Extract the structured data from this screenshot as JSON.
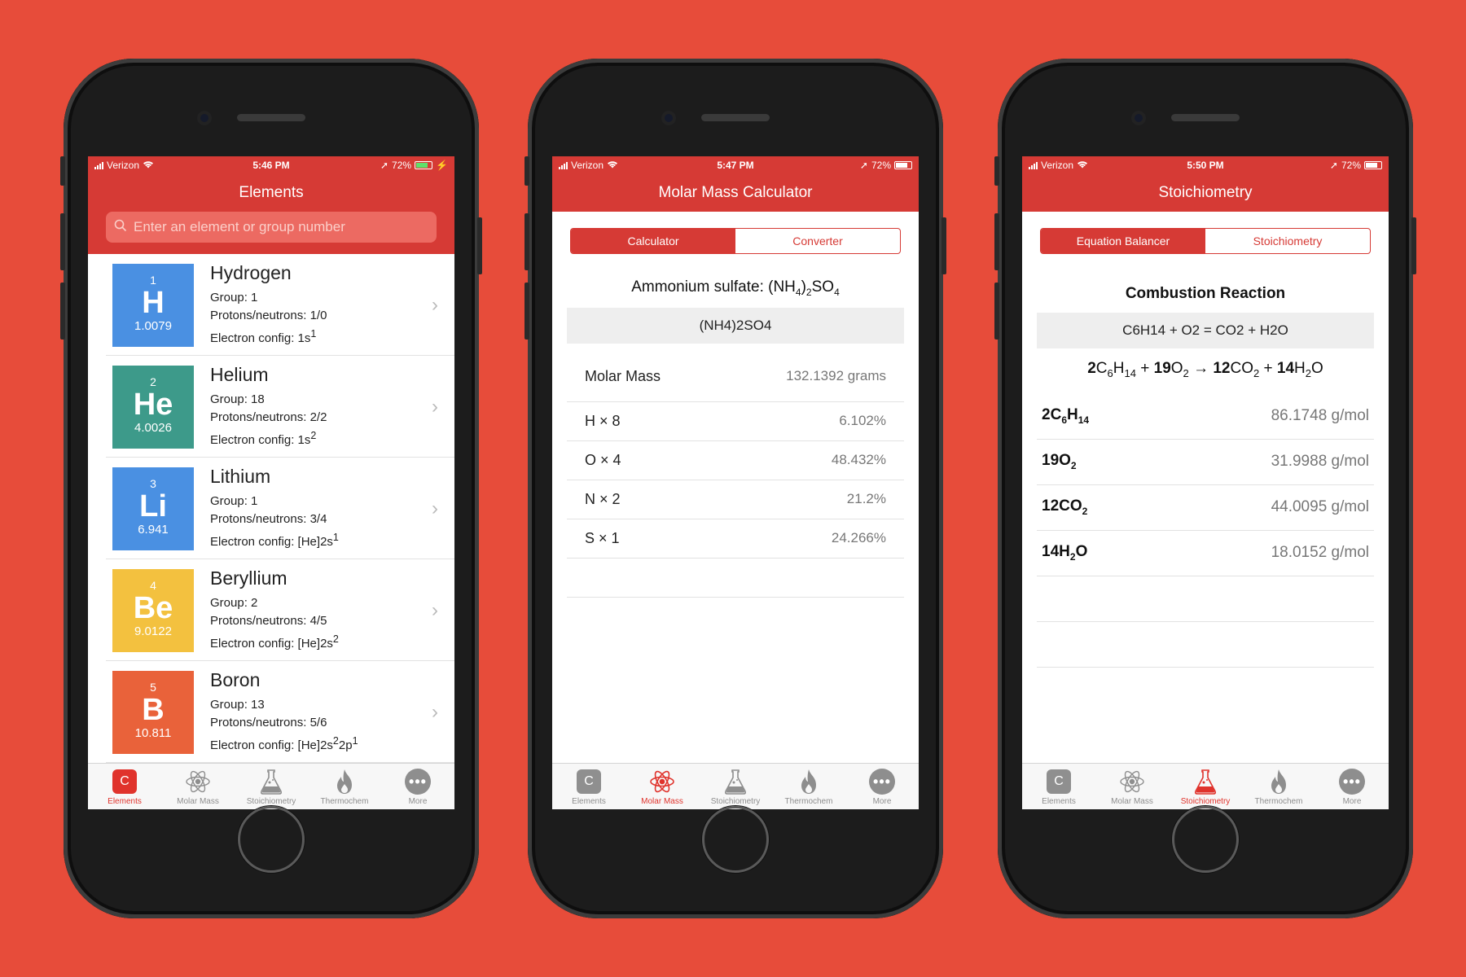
{
  "colors": {
    "background": "#e74c3a",
    "brand": "#d63a35",
    "hydrogen": "#4a90e2",
    "helium": "#3d9a8a",
    "lithium": "#4a90e2",
    "beryllium": "#f3c13f",
    "boron": "#e9623a"
  },
  "tabs": [
    "Elements",
    "Molar Mass",
    "Stoichiometry",
    "Thermochem",
    "More"
  ],
  "tab_c_glyph": "C",
  "phone1": {
    "status": {
      "carrier": "Verizon",
      "time": "5:46 PM",
      "battery": "72%"
    },
    "title": "Elements",
    "search_placeholder": "Enter an element or group number",
    "elements": [
      {
        "number": "1",
        "symbol": "H",
        "mass": "1.0079",
        "name": "Hydrogen",
        "group": "Group: 1",
        "pn": "Protons/neutrons: 1/0",
        "config": "Electron config: 1s",
        "sup": "1"
      },
      {
        "number": "2",
        "symbol": "He",
        "mass": "4.0026",
        "name": "Helium",
        "group": "Group: 18",
        "pn": "Protons/neutrons: 2/2",
        "config": "Electron config: 1s",
        "sup": "2"
      },
      {
        "number": "3",
        "symbol": "Li",
        "mass": "6.941",
        "name": "Lithium",
        "group": "Group: 1",
        "pn": "Protons/neutrons: 3/4",
        "config": "Electron config: [He]2s",
        "sup": "1"
      },
      {
        "number": "4",
        "symbol": "Be",
        "mass": "9.0122",
        "name": "Beryllium",
        "group": "Group: 2",
        "pn": "Protons/neutrons: 4/5",
        "config": "Electron config: [He]2s",
        "sup": "2"
      },
      {
        "number": "5",
        "symbol": "B",
        "mass": "10.811",
        "name": "Boron",
        "group": "Group: 13",
        "pn": "Protons/neutrons: 5/6",
        "config_a": "Electron config: [He]2s",
        "sup_a": "2",
        "config_b": "2p",
        "sup_b": "1"
      }
    ]
  },
  "phone2": {
    "status": {
      "carrier": "Verizon",
      "time": "5:47 PM",
      "battery": "72%"
    },
    "title": "Molar Mass Calculator",
    "segments": [
      "Calculator",
      "Converter"
    ],
    "compound_label": "Ammonium sulfate: (NH",
    "compound_sub1": "4",
    "compound_mid": ")",
    "compound_sub2": "2",
    "compound_so": "SO",
    "compound_sub3": "4",
    "input_value": "(NH4)2SO4",
    "molar_mass_label": "Molar Mass",
    "molar_mass_value": "132.1392 grams",
    "composition": [
      {
        "label": "H × 8",
        "value": "6.102%"
      },
      {
        "label": "O × 4",
        "value": "48.432%"
      },
      {
        "label": "N × 2",
        "value": "21.2%"
      },
      {
        "label": "S × 1",
        "value": "24.266%"
      }
    ]
  },
  "phone3": {
    "status": {
      "carrier": "Verizon",
      "time": "5:50 PM",
      "battery": "72%"
    },
    "title": "Stoichiometry",
    "segments": [
      "Equation Balancer",
      "Stoichiometry"
    ],
    "reaction_title": "Combustion Reaction",
    "equation_input": "C6H14 + O2 = CO2 + H2O",
    "arrow": "→",
    "plus": "+",
    "coef": [
      "2",
      "19",
      "12",
      "14"
    ],
    "masses": [
      "86.1748 g/mol",
      "31.9988 g/mol",
      "44.0095 g/mol",
      "18.0152 g/mol"
    ]
  }
}
